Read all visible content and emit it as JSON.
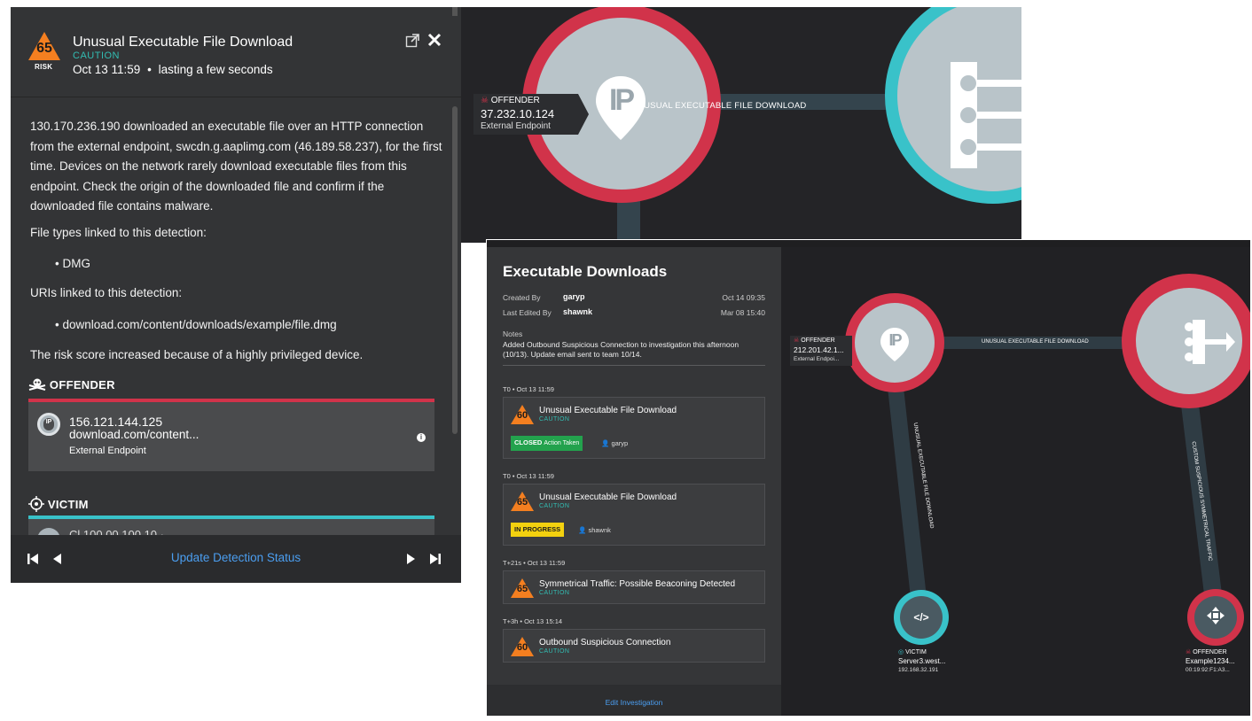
{
  "detection": {
    "risk_score": "65",
    "risk_label": "RISK",
    "title": "Unusual Executable File Download",
    "category": "CAUTION",
    "time": "Oct 13 11:59",
    "duration": "lasting a few seconds",
    "description": "130.170.236.190 downloaded an executable file over an HTTP connection from the external endpoint, swcdn.g.aaplimg.com (46.189.58.237), for the first time. Devices on the network rarely download executable files from this endpoint. Check the origin of the downloaded file and confirm if the downloaded file contains malware.",
    "file_types_label": "File types linked to this detection:",
    "file_types": [
      "DMG"
    ],
    "uris_label": "URIs linked to this detection:",
    "uris": [
      "download.com/content/downloads/example/file.dmg"
    ],
    "risk_note": "The risk score increased because of a highly privileged device.",
    "offender_heading": "OFFENDER",
    "offender": {
      "ip": "156.121.144.125",
      "host": "download.com/content...",
      "type": "External Endpoint",
      "icon_text": "IP"
    },
    "victim_heading": "VICTIM",
    "victim_partial": "Cl    100.00.100.10 ·",
    "footer_action": "Update Detection Status"
  },
  "top_graph": {
    "offender_tag": "OFFENDER",
    "offender_ip": "37.232.10.124",
    "offender_type": "External Endpoint",
    "edge_label": "UNUSUAL EXECUTABLE FILE DOWNLOAD",
    "node_icon_text": "IP"
  },
  "investigation": {
    "title": "Executable Downloads",
    "created_by_label": "Created By",
    "created_by": "garyp",
    "created_date": "Oct 14 09:35",
    "edited_by_label": "Last Edited By",
    "edited_by": "shawnk",
    "edited_date": "Mar 08 15:40",
    "notes_label": "Notes",
    "notes": "Added Outbound Suspicious Connection to investigation this afternoon (10/13). Update email sent to team 10/14.",
    "timeline": [
      {
        "time": "T0 • Oct 13 11:59",
        "score": "60",
        "title": "Unusual Executable File Download",
        "category": "CAUTION",
        "status": "CLOSED",
        "status_detail": "Action Taken",
        "user": "garyp"
      },
      {
        "time": "T0 • Oct 13 11:59",
        "score": "65",
        "title": "Unusual Executable File Download",
        "category": "CAUTION",
        "status": "IN PROGRESS",
        "status_detail": "",
        "user": "shawnk"
      },
      {
        "time": "T+21s • Oct 13 11:59",
        "score": "65",
        "title": "Symmetrical Traffic: Possible Beaconing Detected",
        "category": "CAUTION"
      },
      {
        "time": "T+3h • Oct 13 15:14",
        "score": "60",
        "title": "Outbound Suspicious Connection",
        "category": "CAUTION"
      }
    ],
    "footer_action": "Edit Investigation"
  },
  "inv_graph": {
    "offender1": {
      "tag": "OFFENDER",
      "ip": "212.201.42.1...",
      "type": "External Endpoi...",
      "icon_text": "IP"
    },
    "edge_top": "UNUSUAL EXECUTABLE FILE DOWNLOAD",
    "edge_left": "UNUSUAL EXECUTABLE FILE DOWNLOAD",
    "edge_right": "CUSTOM SUSPICIOUS SYMMETRICAL TRAFFIC",
    "victim": {
      "tag": "VICTIM",
      "name": "Server3.west...",
      "ip": "192.168.32.191",
      "icon_text": "</>"
    },
    "offender2": {
      "tag": "OFFENDER",
      "name": "Example1234...",
      "mac": "00:19:92:F1:A3..."
    }
  },
  "colors": {
    "risk": "#f47f20",
    "caution": "#32bdb3",
    "offender": "#d1334a",
    "victim": "#39c2c9",
    "link": "#4b9ef0",
    "closed": "#23a24d",
    "in_progress": "#f3d10f"
  }
}
